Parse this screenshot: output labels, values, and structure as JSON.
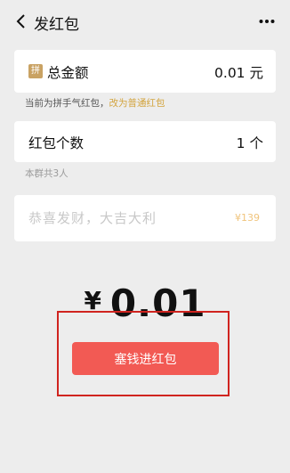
{
  "nav": {
    "title": "发红包"
  },
  "amount_row": {
    "badge": "拼",
    "label": "总金额",
    "value": "0.01",
    "unit": "元"
  },
  "type_hint": {
    "text": "当前为拼手气红包，",
    "link": "改为普通红包"
  },
  "count_row": {
    "label": "红包个数",
    "value": "1",
    "unit": "个"
  },
  "group_hint": "本群共3人",
  "greeting": {
    "placeholder": "恭喜发财，大吉大利",
    "tag": "¥139"
  },
  "total": {
    "currency": "¥",
    "amount": "0.01"
  },
  "submit_label": "塞钱进红包"
}
